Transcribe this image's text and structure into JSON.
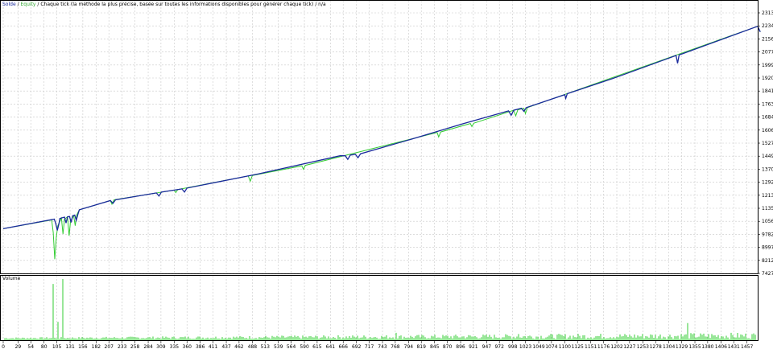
{
  "header": {
    "solde": "Solde",
    "sep": " / ",
    "equite": "Equity",
    "rest": " / Chaque tick (la méthode la plus précise, basée sur toutes les informations disponibles pour générer chaque tick) / n/a"
  },
  "colors": {
    "balance": "#1a2a9c",
    "equity": "#33cc33",
    "volume": "#33cc33",
    "grid": "#c8c8c8",
    "frame": "#000000"
  },
  "chart_data": [
    {
      "type": "line",
      "title": "",
      "grid": true,
      "ylim": [
        7427,
        23130
      ],
      "yticks": [
        7427,
        8212,
        8997,
        9782,
        10567,
        11353,
        12138,
        12923,
        13708,
        14493,
        15278,
        16064,
        16849,
        17634,
        18419,
        19204,
        19990,
        20775,
        21560,
        22345,
        23130
      ],
      "xlim": [
        0,
        1478
      ],
      "xticks": [
        0,
        29,
        54,
        80,
        105,
        131,
        156,
        182,
        207,
        233,
        258,
        284,
        309,
        335,
        360,
        386,
        411,
        437,
        462,
        488,
        513,
        539,
        564,
        590,
        615,
        641,
        666,
        692,
        717,
        743,
        768,
        794,
        819,
        845,
        870,
        896,
        921,
        947,
        972,
        998,
        1023,
        1049,
        1074,
        1100,
        1125,
        1151,
        1176,
        1202,
        1227,
        1253,
        1278,
        1304,
        1329,
        1355,
        1380,
        1406,
        1431,
        1457
      ],
      "series": [
        {
          "name": "Solde",
          "points": [
            [
              0,
              10120
            ],
            [
              100,
              10700
            ],
            [
              103,
              10420
            ],
            [
              106,
              10020
            ],
            [
              109,
              10400
            ],
            [
              111,
              10740
            ],
            [
              120,
              10820
            ],
            [
              123,
              10460
            ],
            [
              126,
              10840
            ],
            [
              130,
              10860
            ],
            [
              133,
              10500
            ],
            [
              136,
              10900
            ],
            [
              140,
              10940
            ],
            [
              143,
              10620
            ],
            [
              146,
              10960
            ],
            [
              149,
              11260
            ],
            [
              210,
              11820
            ],
            [
              215,
              11650
            ],
            [
              220,
              11860
            ],
            [
              300,
              12280
            ],
            [
              305,
              12090
            ],
            [
              310,
              12330
            ],
            [
              350,
              12520
            ],
            [
              355,
              12330
            ],
            [
              360,
              12570
            ],
            [
              500,
              13420
            ],
            [
              660,
              14520
            ],
            [
              670,
              14520
            ],
            [
              675,
              14300
            ],
            [
              680,
              14560
            ],
            [
              690,
              14600
            ],
            [
              695,
              14400
            ],
            [
              700,
              14640
            ],
            [
              800,
              15520
            ],
            [
              900,
              16440
            ],
            [
              990,
              17220
            ],
            [
              995,
              16960
            ],
            [
              1000,
              17260
            ],
            [
              1015,
              17380
            ],
            [
              1020,
              17200
            ],
            [
              1025,
              17420
            ],
            [
              1100,
              18200
            ],
            [
              1102,
              17980
            ],
            [
              1105,
              18260
            ],
            [
              1200,
              19240
            ],
            [
              1300,
              20360
            ],
            [
              1318,
              20560
            ],
            [
              1321,
              20090
            ],
            [
              1324,
              20600
            ],
            [
              1330,
              20660
            ],
            [
              1478,
              22320
            ],
            [
              1483,
              21980
            ]
          ]
        },
        {
          "name": "Equity",
          "points": [
            [
              0,
              10120
            ],
            [
              95,
              10650
            ],
            [
              98,
              9900
            ],
            [
              101,
              8280
            ],
            [
              104,
              9600
            ],
            [
              107,
              10300
            ],
            [
              114,
              10760
            ],
            [
              117,
              9800
            ],
            [
              120,
              10700
            ],
            [
              126,
              10840
            ],
            [
              129,
              9700
            ],
            [
              132,
              10600
            ],
            [
              138,
              10900
            ],
            [
              141,
              10300
            ],
            [
              144,
              10950
            ],
            [
              149,
              11260
            ],
            [
              210,
              11820
            ],
            [
              213,
              11600
            ],
            [
              217,
              11860
            ],
            [
              335,
              12450
            ],
            [
              338,
              12300
            ],
            [
              342,
              12480
            ],
            [
              480,
              13300
            ],
            [
              484,
              12980
            ],
            [
              488,
              13330
            ],
            [
              585,
              13910
            ],
            [
              588,
              13700
            ],
            [
              592,
              13940
            ],
            [
              850,
              15920
            ],
            [
              853,
              15650
            ],
            [
              857,
              15950
            ],
            [
              915,
              16460
            ],
            [
              918,
              16280
            ],
            [
              922,
              16480
            ],
            [
              1000,
              17260
            ],
            [
              1004,
              16920
            ],
            [
              1008,
              17280
            ],
            [
              1020,
              17380
            ],
            [
              1023,
              17060
            ],
            [
              1027,
              17420
            ],
            [
              1478,
              22320
            ],
            [
              1483,
              21980
            ]
          ]
        }
      ]
    },
    {
      "type": "bar",
      "title": "Volume",
      "xlabel": "",
      "ylabel": "",
      "xlim": [
        0,
        1478
      ],
      "ylim": [
        0,
        100
      ],
      "spikes": [
        [
          98,
          92
        ],
        [
          109,
          30
        ],
        [
          116,
          100
        ],
        [
          1341,
          28
        ],
        [
          772,
          12
        ],
        [
          1009,
          10
        ]
      ]
    }
  ]
}
